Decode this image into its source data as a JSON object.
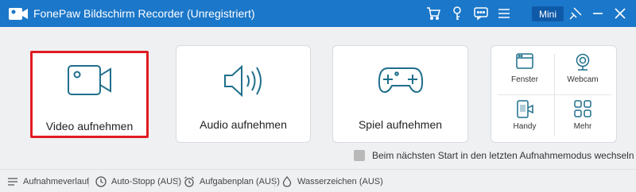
{
  "window": {
    "title": "FonePaw Bildschirm Recorder (Unregistriert)",
    "mini_label": "Mini",
    "icons": [
      "camera-logo-icon",
      "cart-icon",
      "key-icon",
      "chat-icon",
      "menu-icon",
      "pin-icon",
      "minimize-icon",
      "close-icon"
    ]
  },
  "cards": {
    "video": "Video aufnehmen",
    "audio": "Audio aufnehmen",
    "game": "Spiel aufnehmen"
  },
  "multi": {
    "window": "Fenster",
    "webcam": "Webcam",
    "phone": "Handy",
    "more": "Mehr"
  },
  "option": {
    "remember_mode": "Beim nächsten Start in den letzten Aufnahmemodus wechseln"
  },
  "bottom": {
    "history": "Aufnahmeverlauf",
    "auto_stop": "Auto-Stopp (AUS)",
    "schedule": "Aufgabenplan (AUS)",
    "watermark": "Wasserzeichen (AUS)"
  },
  "colors": {
    "titlebar": "#1b77c9",
    "accent_icon": "#1f6f8b",
    "selection_border": "#e11b22"
  }
}
